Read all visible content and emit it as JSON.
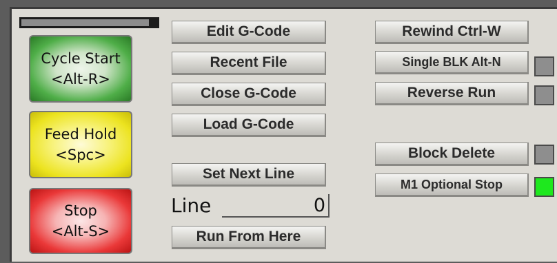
{
  "progress": {
    "fraction": 0.94
  },
  "cycle_start": {
    "line1": "Cycle Start",
    "line2": "<Alt-R>",
    "color": "#3fa83a"
  },
  "feed_hold": {
    "line1": "Feed Hold",
    "line2": "<Spc>",
    "color": "#ece31f"
  },
  "stop": {
    "line1": "Stop",
    "line2": "<Alt-S>",
    "color": "#e22a2a"
  },
  "file_buttons": {
    "edit": "Edit G-Code",
    "recent": "Recent File",
    "close": "Close G-Code",
    "load": "Load G-Code"
  },
  "set_next_line": "Set Next Line",
  "line_field": {
    "label": "Line",
    "value": "0"
  },
  "run_from_here": "Run From Here",
  "right_buttons": {
    "rewind": "Rewind Ctrl-W",
    "single_block": "Single BLK Alt-N",
    "reverse_run": "Reverse Run",
    "block_delete": "Block Delete",
    "optional_stop": "M1 Optional Stop"
  },
  "indicators": {
    "single_block": {
      "active": false,
      "color": "#8e8e8e"
    },
    "reverse_run": {
      "active": false,
      "color": "#8e8e8e"
    },
    "block_delete": {
      "active": false,
      "color": "#8e8e8e"
    },
    "optional_stop": {
      "active": true,
      "color": "#1ee81e"
    }
  }
}
